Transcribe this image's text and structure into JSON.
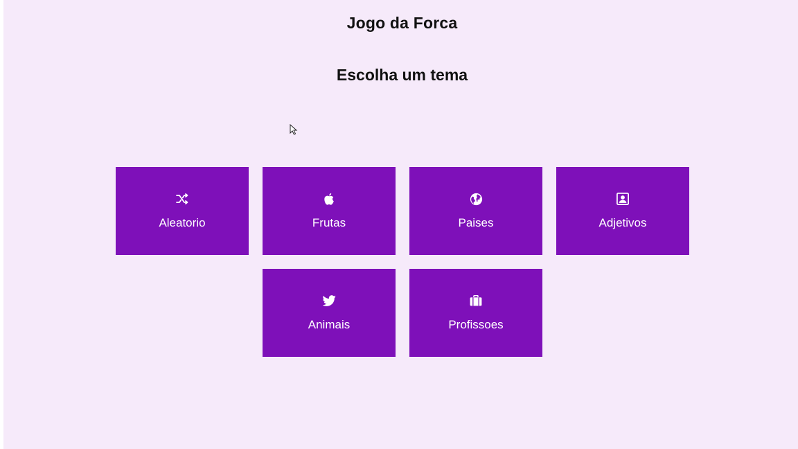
{
  "header": {
    "title": "Jogo da Forca",
    "subtitle": "Escolha um tema"
  },
  "colors": {
    "background": "#f6eafa",
    "card": "#7e10b9",
    "card_text": "#ffffff"
  },
  "themes": [
    {
      "label": "Aleatorio",
      "icon": "shuffle-icon"
    },
    {
      "label": "Frutas",
      "icon": "apple-icon"
    },
    {
      "label": "Paises",
      "icon": "globe-icon"
    },
    {
      "label": "Adjetivos",
      "icon": "portrait-icon"
    },
    {
      "label": "Animais",
      "icon": "twitter-bird-icon"
    },
    {
      "label": "Profissoes",
      "icon": "briefcase-icon"
    }
  ]
}
